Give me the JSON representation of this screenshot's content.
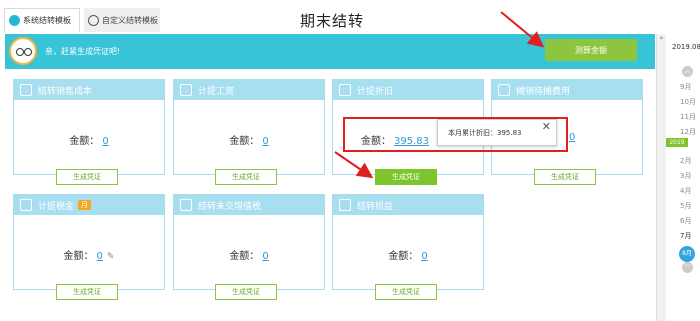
{
  "tabs": [
    {
      "label": "系统结转模板",
      "icon": "home-icon"
    },
    {
      "label": "自定义结转模板",
      "icon": "refresh-icon"
    }
  ],
  "page_title": "期末结转",
  "banner": {
    "message": "亲，赶紧生成凭证吧!",
    "calc_button": "测算金额"
  },
  "amount_label": "金额：",
  "generate_label": "生成凭证",
  "cards": [
    {
      "title": "结转销售成本",
      "value": "0",
      "icon": "chart-icon"
    },
    {
      "title": "计提工资",
      "value": "0",
      "icon": "wallet-icon"
    },
    {
      "title": "计提折旧",
      "value": "395.83",
      "icon": "building-icon"
    },
    {
      "title": "摊销待摊费用",
      "value": "0",
      "icon": "money-icon"
    },
    {
      "title": "计提税金",
      "value": "0",
      "icon": "tax-icon",
      "badge": "月"
    },
    {
      "title": "结转未交增值税",
      "value": "0",
      "icon": "invoice-icon"
    },
    {
      "title": "结转损益",
      "value": "0",
      "icon": "coins-icon"
    }
  ],
  "tooltip": {
    "text": "本月累计折旧：395.83",
    "close": "✕"
  },
  "calendar": {
    "year_label": "2019.08",
    "up": "︿",
    "down": "﹀",
    "items_before": [
      "9月",
      "10月",
      "11月",
      "12月"
    ],
    "year_badge": "2019",
    "items_after": [
      "2月",
      "3月",
      "4月",
      "5月",
      "6月",
      "7月"
    ],
    "selected": "8月",
    "collapse": "»"
  },
  "colors": {
    "accent": "#38c3d7",
    "green": "#8cc63f",
    "highlight": "#e02020",
    "link": "#2f9bd4"
  }
}
